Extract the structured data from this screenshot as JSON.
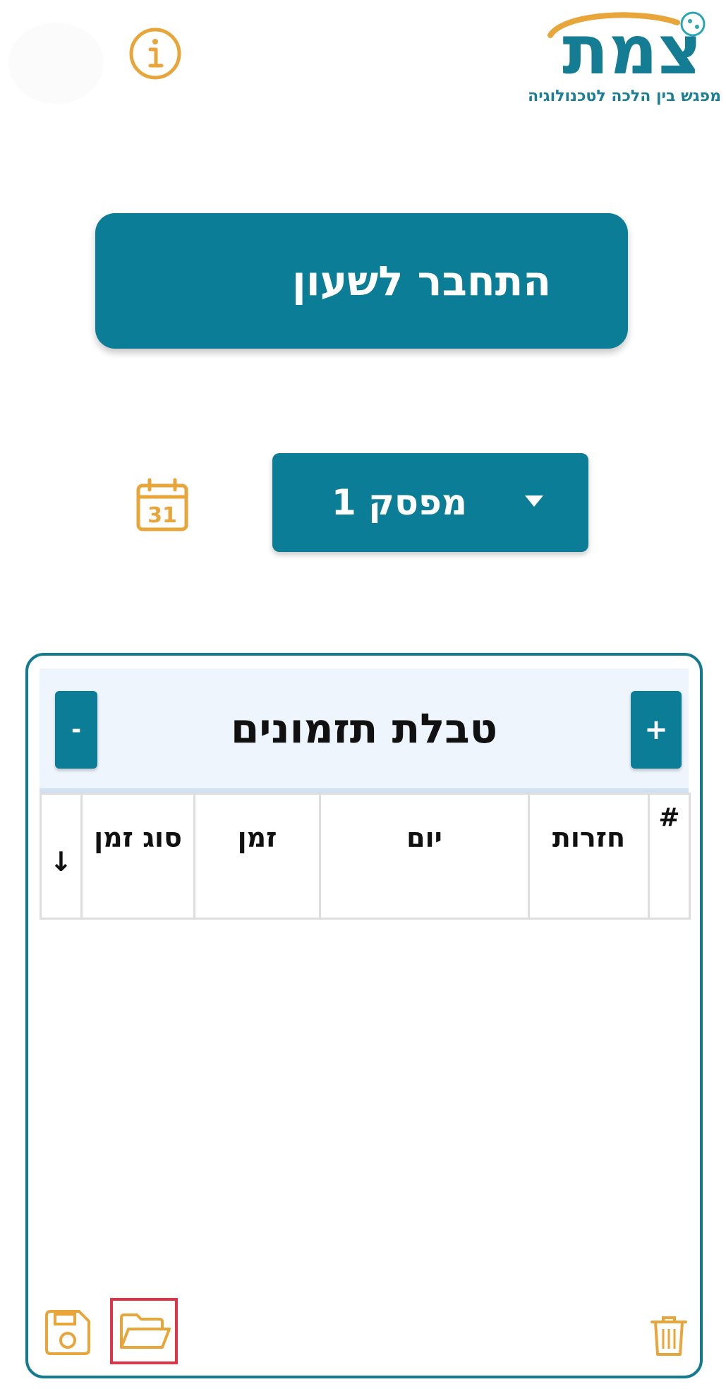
{
  "app": {
    "logo_word": "צמת",
    "logo_tagline": "מפגש בין הלכה לטכנולוגיה"
  },
  "header": {
    "info_icon": "info-circle-icon"
  },
  "connect": {
    "label": "התחבר לשעון",
    "icon": "search-icon"
  },
  "timer": {
    "calendar_icon": "calendar-31-icon",
    "calendar_day": "31",
    "selected": "מפסק 1",
    "dropdown_icon": "caret-down-icon"
  },
  "schedule": {
    "title": "טבלת תזמונים",
    "add_label": "+",
    "remove_label": "-",
    "columns": [
      "#",
      "חזרות",
      "יום",
      "זמן",
      "סוג זמן",
      "↓"
    ],
    "rows": [],
    "footer": {
      "delete_icon": "trash-icon",
      "open_icon": "folder-open-icon",
      "save_icon": "floppy-disk-icon"
    }
  },
  "colors": {
    "primary": "#0c7d96",
    "accent": "#e8a63a",
    "card_border": "#137a8f",
    "header_bg": "#eef5fd",
    "highlight": "#e03448"
  }
}
